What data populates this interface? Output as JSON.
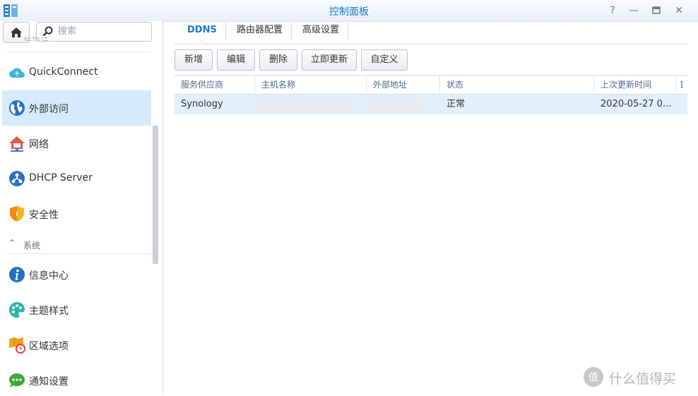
{
  "window": {
    "title": "控制面板"
  },
  "window_controls": [
    "help",
    "minimize",
    "maximize",
    "close"
  ],
  "search": {
    "placeholder": "搜索"
  },
  "sidebar": {
    "sections": [
      {
        "label": "连接性",
        "partial": true
      },
      {
        "label": "系统"
      }
    ],
    "items": [
      {
        "label": "QuickConnect",
        "icon": "quickconnect-icon"
      },
      {
        "label": "外部访问",
        "icon": "globe-icon",
        "active": true
      },
      {
        "label": "网络",
        "icon": "network-house-icon"
      },
      {
        "label": "DHCP Server",
        "icon": "dhcp-icon"
      },
      {
        "label": "安全性",
        "icon": "shield-icon"
      },
      {
        "label": "信息中心",
        "icon": "info-icon"
      },
      {
        "label": "主题样式",
        "icon": "palette-icon"
      },
      {
        "label": "区域选项",
        "icon": "region-clock-icon"
      },
      {
        "label": "通知设置",
        "icon": "notification-icon"
      }
    ]
  },
  "tabs": [
    {
      "label": "DDNS",
      "active": true
    },
    {
      "label": "路由器配置"
    },
    {
      "label": "高级设置"
    }
  ],
  "toolbar": {
    "add": "新增",
    "edit": "编辑",
    "delete": "删除",
    "update_now": "立即更新",
    "customize": "自定义"
  },
  "grid": {
    "columns": [
      "服务供应商",
      "主机名称",
      "外部地址",
      "状态",
      "上次更新时间"
    ],
    "column_menu": "⋮",
    "rows": [
      {
        "provider": "Synology",
        "hostname": "",
        "external_address": "",
        "status": "正常",
        "last_update": "2020-05-27 0..."
      }
    ]
  },
  "watermark": {
    "text": "什么值得买",
    "mark": "值"
  },
  "colors": {
    "accent": "#1d77c9",
    "selected_row": "#e3f0fb",
    "active_nav": "#d5ebfb",
    "status_ok": "#2a9d2a"
  }
}
